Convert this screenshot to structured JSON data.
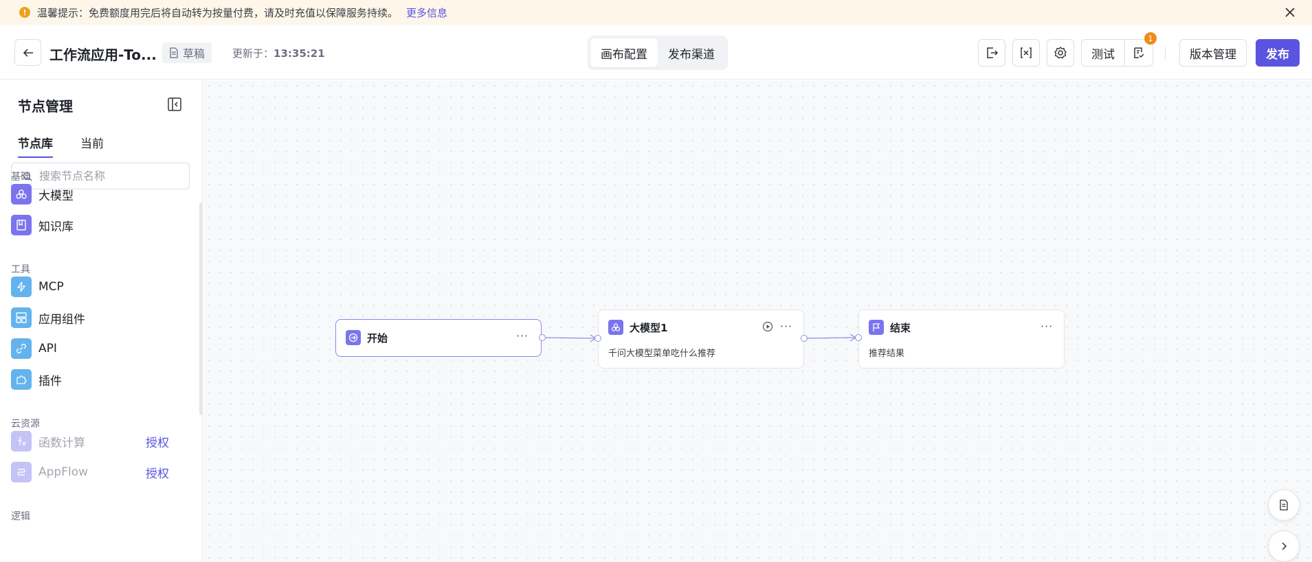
{
  "notice": {
    "text": "温馨提示：免费额度用完后将自动转为按量付费，请及时充值以保障服务持续。",
    "link": "更多信息"
  },
  "header": {
    "title": "工作流应用-To...",
    "status": "草稿",
    "updated_label": "更新于：",
    "updated_time": "13:35:21",
    "tabs": [
      "画布配置",
      "发布渠道"
    ],
    "test_label": "测试",
    "badge_count": "1",
    "version_label": "版本管理",
    "publish_label": "发布"
  },
  "sidebar": {
    "title": "节点管理",
    "tabs": [
      "节点库",
      "当前"
    ],
    "search_placeholder": "搜索节点名称",
    "groups": [
      {
        "label": "基础",
        "items": [
          "大模型",
          "知识库"
        ]
      },
      {
        "label": "工具",
        "items": [
          "MCP",
          "应用组件",
          "API",
          "插件"
        ]
      },
      {
        "label": "云资源",
        "items": [
          "函数计算",
          "AppFlow"
        ],
        "action": "授权"
      },
      {
        "label": "逻辑",
        "items": []
      }
    ]
  },
  "canvas": {
    "nodes": [
      {
        "title": "开始",
        "desc": ""
      },
      {
        "title": "大模型1",
        "desc": "千问大模型菜单吃什么推荐"
      },
      {
        "title": "结束",
        "desc": "推荐结果"
      }
    ]
  },
  "colors": {
    "accent": "#5b54e0",
    "notice_bg": "#fdf6e9",
    "badge": "#f08a1c"
  }
}
